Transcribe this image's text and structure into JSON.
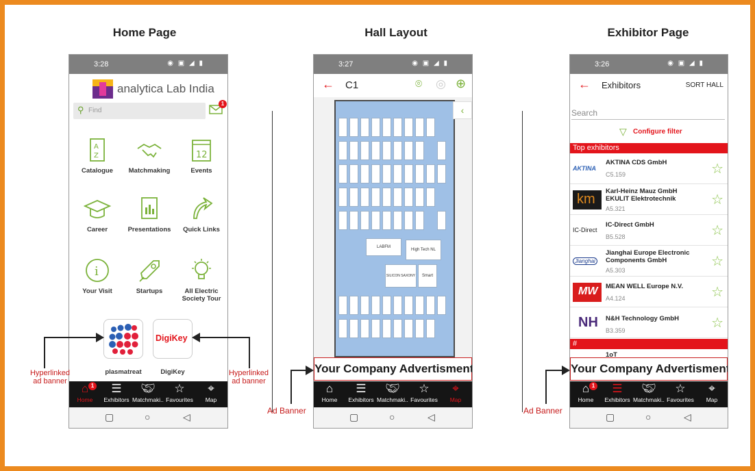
{
  "columns": {
    "home_title": "Home Page",
    "hall_title": "Hall Layout",
    "exhibitor_title": "Exhibitor Page"
  },
  "home": {
    "status_time": "3:28",
    "brand": "analytica Lab India",
    "search_placeholder": "Find",
    "mail_badge": "1",
    "tiles": [
      {
        "label": "Catalogue",
        "icon": "catalogue-az-icon"
      },
      {
        "label": "Matchmaking",
        "icon": "handshake-icon"
      },
      {
        "label": "Events",
        "icon": "calendar-icon"
      },
      {
        "label": "Career",
        "icon": "graduation-cap-icon"
      },
      {
        "label": "Presentations",
        "icon": "presentation-icon"
      },
      {
        "label": "Quick Links",
        "icon": "arrow-link-icon"
      },
      {
        "label": "Your Visit",
        "icon": "info-icon"
      },
      {
        "label": "Startups",
        "icon": "rocket-icon"
      },
      {
        "label": "All Electric Society Tour",
        "icon": "lightbulb-icon"
      }
    ],
    "sponsors": [
      {
        "label": "plasmatreat"
      },
      {
        "label": "DigiKey",
        "logo_text": "DigiKey"
      }
    ],
    "annotation_left": "Hyperlinked ad banner",
    "annotation_right": "Hyperlinked ad banner"
  },
  "hall": {
    "status_time": "3:27",
    "hall_name": "C1",
    "ad_text": "Your Company Advertisment",
    "annotation": "Ad Banner",
    "booth_labels": [
      "LABFM",
      "High Tech NL",
      "SILICON SAXONY",
      "Smart"
    ]
  },
  "exhibitor": {
    "status_time": "3:26",
    "title": "Exhibitors",
    "sort": "SORT HALL",
    "search_placeholder": "Search",
    "filter": "Configure filter",
    "section_top": "Top exhibitors",
    "section_hash": "#",
    "items": [
      {
        "name": "AKTINA CDS GmbH",
        "hall": "C5.159",
        "logo": "AKTINA"
      },
      {
        "name": "Karl-Heinz Mauz GmbH EKULIT Elektrotechnik",
        "hall": "A5.321",
        "logo": "km"
      },
      {
        "name": "IC-Direct GmbH",
        "hall": "B5.528",
        "logo": "IC-Direct"
      },
      {
        "name": "Jianghai Europe Electronic Components GmbH",
        "hall": "A5.303",
        "logo": "Jianghai"
      },
      {
        "name": "MEAN WELL Europe N.V.",
        "hall": "A4.124",
        "logo": "MW"
      },
      {
        "name": "N&H Technology GmbH",
        "hall": "B3.359",
        "logo": "NH"
      }
    ],
    "partial_item": "1oT",
    "ad_text": "Your Company Advertisment",
    "annotation": "Ad Banner"
  },
  "nav": {
    "items": [
      {
        "label": "Home",
        "icon": "home-icon"
      },
      {
        "label": "Exhibitors",
        "icon": "menu-icon"
      },
      {
        "label": "Matchmaki...",
        "icon": "handshake-icon"
      },
      {
        "label": "Favourites",
        "icon": "star-icon"
      },
      {
        "label": "Map",
        "icon": "map-icon"
      }
    ],
    "home_badge": "1"
  },
  "colors": {
    "frame": "#ec8a1f",
    "accent_red": "#e3141b",
    "green": "#8bc34a",
    "hall_blue": "#9fc0e6"
  }
}
